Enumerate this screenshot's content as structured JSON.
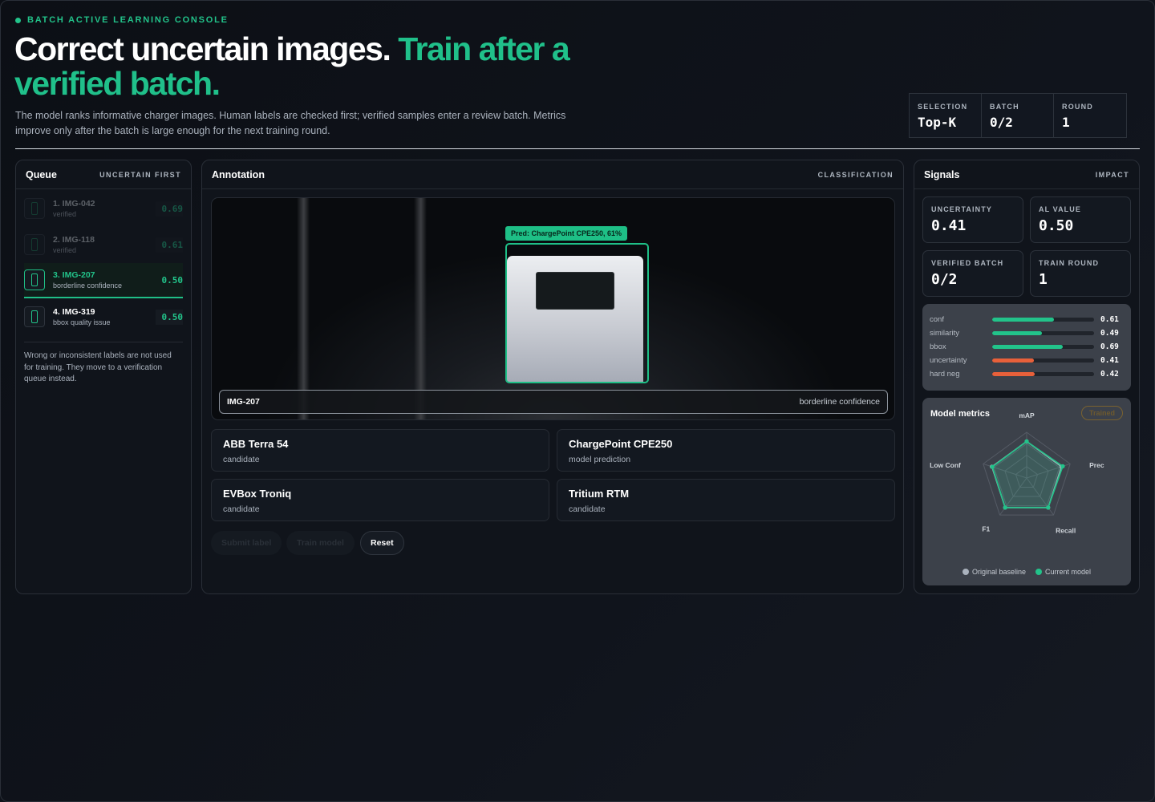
{
  "header": {
    "eyebrow": "BATCH ACTIVE LEARNING CONSOLE",
    "title_main": "Correct uncertain images.",
    "title_accent": "Train after a verified batch.",
    "subtitle": "The model ranks informative charger images. Human labels are checked first; verified samples enter a review batch. Metrics improve only after the batch is large enough for the next training round."
  },
  "stats": [
    {
      "label": "SELECTION",
      "value": "Top-K"
    },
    {
      "label": "BATCH",
      "value": "0/2"
    },
    {
      "label": "ROUND",
      "value": "1"
    }
  ],
  "queue": {
    "title": "Queue",
    "tag": "UNCERTAIN FIRST",
    "items": [
      {
        "name": "1. IMG-042",
        "meta": "verified",
        "score": "0.69"
      },
      {
        "name": "2. IMG-118",
        "meta": "verified",
        "score": "0.61"
      },
      {
        "name": "3. IMG-207",
        "meta": "borderline confidence",
        "score": "0.50"
      },
      {
        "name": "4. IMG-319",
        "meta": "bbox quality issue",
        "score": "0.50"
      }
    ],
    "note": "Wrong or inconsistent labels are not used for training. They move to a verification queue instead."
  },
  "annotation": {
    "title": "Annotation",
    "tag": "CLASSIFICATION",
    "prediction": "Pred: ChargePoint CPE250, 61%",
    "image_id": "IMG-207",
    "image_reason": "borderline confidence",
    "choices": [
      {
        "name": "ABB Terra 54",
        "sub": "candidate"
      },
      {
        "name": "ChargePoint CPE250",
        "sub": "model prediction"
      },
      {
        "name": "EVBox Troniq",
        "sub": "candidate"
      },
      {
        "name": "Tritium RTM",
        "sub": "candidate"
      }
    ],
    "buttons": {
      "submit": "Submit label",
      "train": "Train model",
      "reset": "Reset"
    }
  },
  "signals": {
    "title": "Signals",
    "tag": "IMPACT",
    "cards": [
      {
        "label": "UNCERTAINTY",
        "value": "0.41"
      },
      {
        "label": "AL VALUE",
        "value": "0.50"
      },
      {
        "label": "VERIFIED BATCH",
        "value": "0/2"
      },
      {
        "label": "TRAIN ROUND",
        "value": "1"
      }
    ],
    "bars": [
      {
        "label": "conf",
        "value": "0.61",
        "fraction": 0.61,
        "color": "#22c38a"
      },
      {
        "label": "similarity",
        "value": "0.49",
        "fraction": 0.49,
        "color": "#22c38a"
      },
      {
        "label": "bbox",
        "value": "0.69",
        "fraction": 0.69,
        "color": "#22c38a"
      },
      {
        "label": "uncertainty",
        "value": "0.41",
        "fraction": 0.41,
        "color": "#e8603a"
      },
      {
        "label": "hard neg",
        "value": "0.42",
        "fraction": 0.42,
        "color": "#e8603a"
      }
    ]
  },
  "metrics": {
    "title": "Model metrics",
    "badge": "Trained",
    "axes": [
      "mAP",
      "Prec",
      "Recall",
      "F1",
      "Low Conf"
    ],
    "baseline_values": [
      0.8,
      0.8,
      0.8,
      0.8,
      0.8
    ],
    "current_values": [
      0.8,
      0.83,
      0.8,
      0.8,
      0.79
    ],
    "legend": [
      "Original baseline",
      "Current model"
    ],
    "colors": {
      "baseline": "#aab2bd",
      "current": "#22c38a"
    }
  },
  "colors": {
    "accent": "#22c38a",
    "warning": "#e8603a"
  }
}
